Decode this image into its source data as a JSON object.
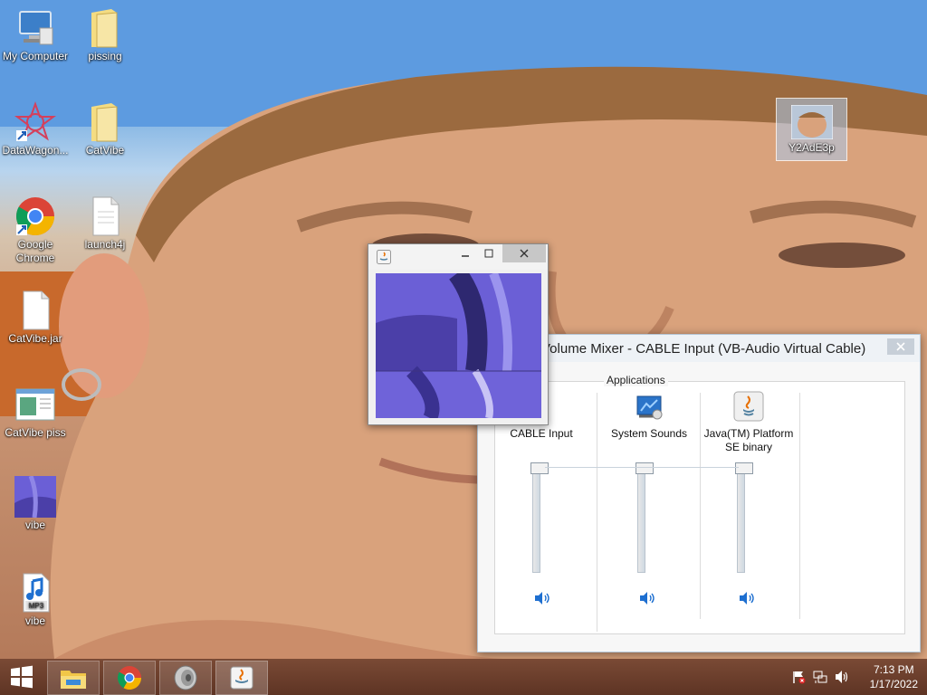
{
  "desktop": {
    "icons": [
      {
        "label": "My Computer",
        "icon": "computer-icon"
      },
      {
        "label": "pissing",
        "icon": "folder-icon"
      },
      {
        "label": "DataWagon...",
        "icon": "star-shortcut-icon"
      },
      {
        "label": "CatVibe",
        "icon": "folder-icon"
      },
      {
        "label": "Google Chrome",
        "icon": "chrome-icon"
      },
      {
        "label": "launch4j",
        "icon": "document-icon"
      },
      {
        "label": "CatVibe.jar",
        "icon": "document-icon"
      },
      {
        "label": "CatVibe piss",
        "icon": "window-app-icon"
      },
      {
        "label": "vibe",
        "icon": "image-thumbnail-icon"
      },
      {
        "label": "vibe",
        "icon": "mp3-icon"
      },
      {
        "label": "Y2AdE3p",
        "icon": "photo-thumbnail-icon",
        "selected": true
      }
    ]
  },
  "java_window": {
    "icon": "java-icon"
  },
  "volume_mixer": {
    "title": "Volume Mixer - CABLE Input (VB-Audio Virtual Cable)",
    "applications_label": "Applications",
    "channels": [
      {
        "name": "CABLE Input",
        "icon": "speaker-device-icon",
        "level": 1.0
      },
      {
        "name": "System Sounds",
        "icon": "system-sounds-icon",
        "level": 1.0
      },
      {
        "name": "Java(TM) Platform SE binary",
        "icon": "java-icon",
        "level": 1.0
      }
    ]
  },
  "taskbar": {
    "start_icon": "windows-logo-icon",
    "pinned": [
      {
        "name": "File Explorer",
        "icon": "file-explorer-icon"
      },
      {
        "name": "Google Chrome",
        "icon": "chrome-icon"
      },
      {
        "name": "Volume",
        "icon": "speaker-icon"
      },
      {
        "name": "Java",
        "icon": "java-icon"
      }
    ],
    "tray_icons": [
      "flag-icon",
      "network-icon",
      "volume-icon"
    ],
    "time": "7:13 PM",
    "date": "1/17/2022"
  },
  "colors": {
    "taskbar": "#6b3d2b",
    "mixer_border": "#b5c6d6",
    "wallpaper_sky": "#6ca7df",
    "wallpaper_skin": "#c99574",
    "purple_video": "#6b5fd6"
  }
}
